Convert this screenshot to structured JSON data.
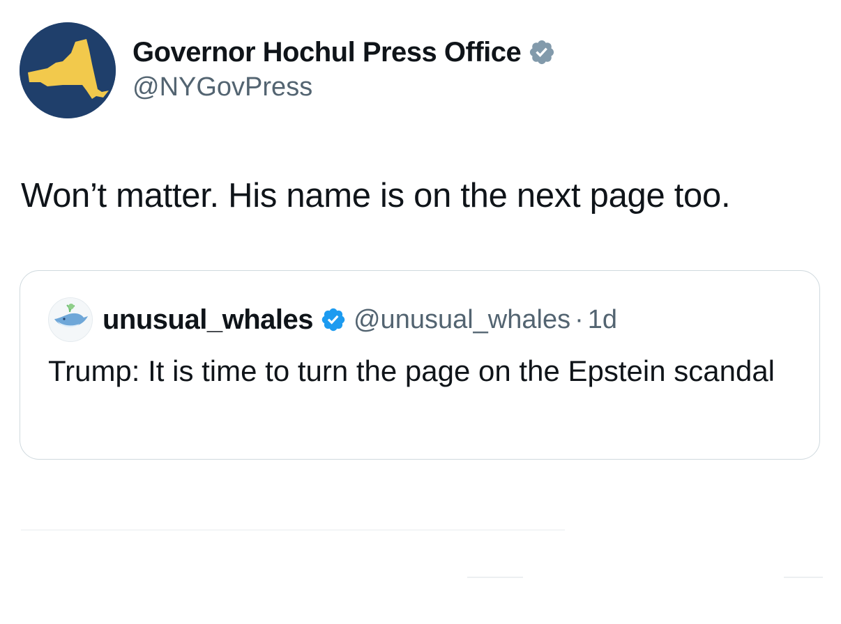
{
  "author": {
    "display_name": "Governor Hochul Press Office",
    "handle": "@NYGovPress",
    "avatar_icon": "new-york-state-map-icon",
    "avatar_bg_color": "#1f3f6b",
    "avatar_fg_color": "#f2c94c",
    "badge_icon": "gray-verified-badge-icon",
    "badge_color": "#829aab"
  },
  "tweet": {
    "text": "Won’t matter. His name is on the next page too."
  },
  "quoted_tweet": {
    "display_name": "unusual_whales",
    "handle": "@unusual_whales",
    "separator": "·",
    "time": "1d",
    "text": "Trump: It is time to turn the page on the Epstein scandal",
    "avatar_icon": "whale-icon",
    "badge_icon": "blue-verified-badge-icon",
    "badge_color": "#1d9bf0"
  }
}
